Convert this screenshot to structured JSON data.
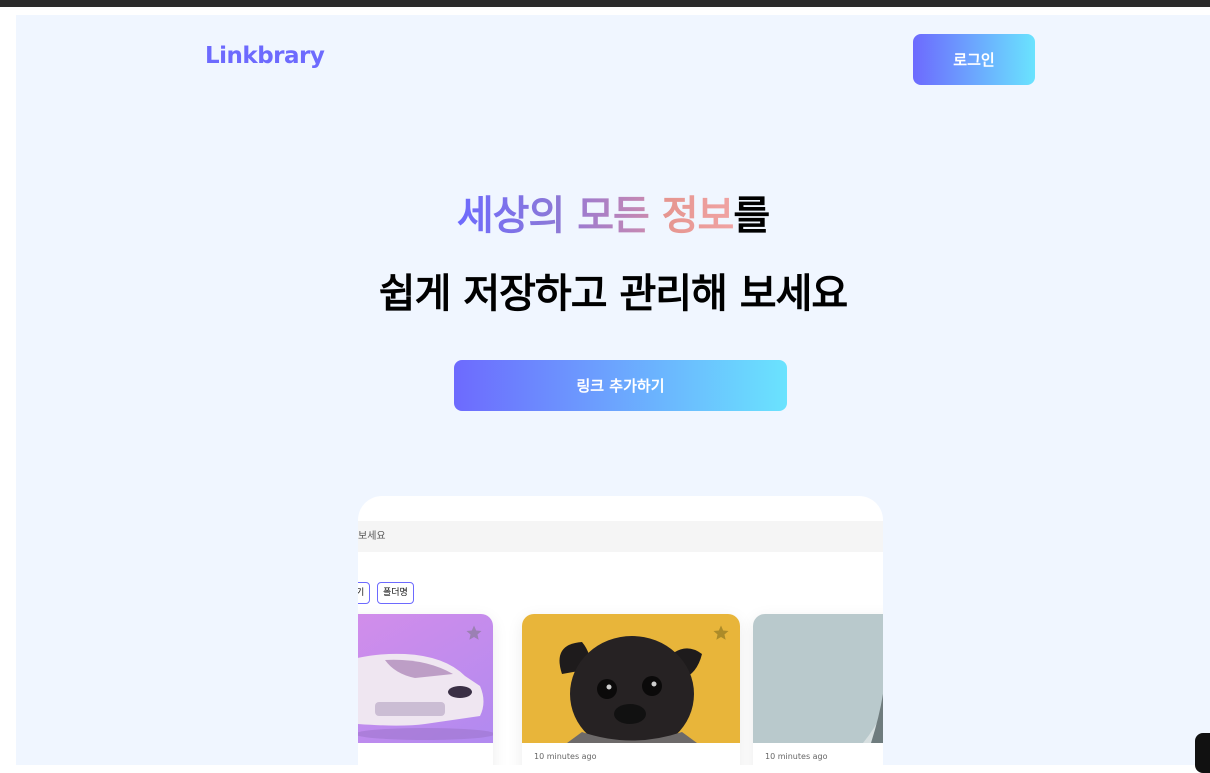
{
  "header": {
    "logo": "Linkbrary",
    "login_label": "로그인"
  },
  "hero": {
    "line1": {
      "part1": "세상의",
      "part2": "모든",
      "part3": "정보",
      "part4": "를"
    },
    "line2": "쉽게 저장하고 관리해 보세요",
    "cta_label": "링크 추가하기"
  },
  "preview": {
    "search_text": "보세요",
    "chips": [
      "기",
      "폴더명"
    ],
    "cards": [
      {
        "time": "",
        "image": "car-photo"
      },
      {
        "time": "10 minutes ago",
        "image": "pug-photo"
      },
      {
        "time": "10 minutes ago",
        "image": "building-photo"
      }
    ]
  },
  "colors": {
    "primary": "#6d6afe",
    "gradient_end": "#6ae3fe",
    "background": "#f0f6ff",
    "card_yellow": "#e8b53a"
  },
  "icons": [
    "star-icon",
    "chat-icon"
  ]
}
